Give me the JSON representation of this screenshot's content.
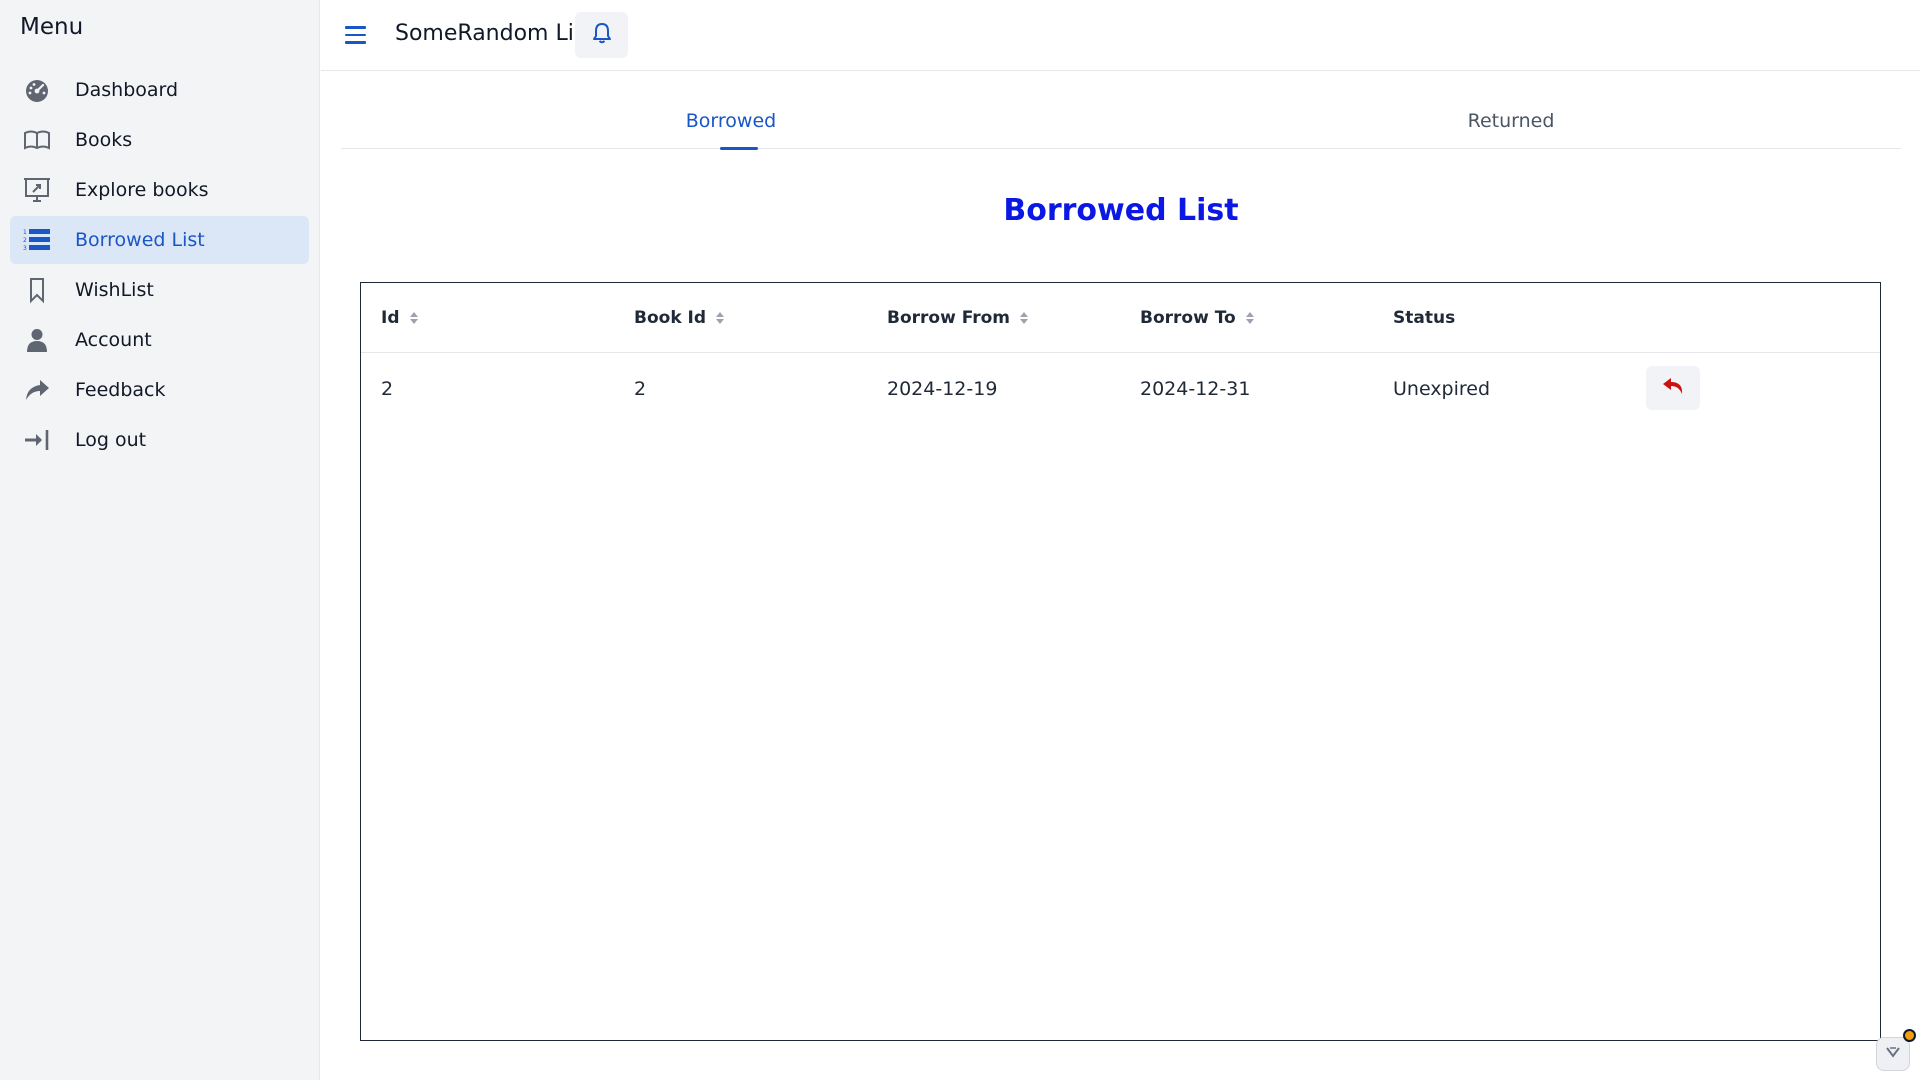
{
  "sidebar": {
    "title": "Menu",
    "items": [
      {
        "label": "Dashboard",
        "icon": "dashboard-gauge-icon",
        "active": false
      },
      {
        "label": "Books",
        "icon": "open-book-icon",
        "active": false
      },
      {
        "label": "Explore books",
        "icon": "explore-presentation-icon",
        "active": false
      },
      {
        "label": "Borrowed List",
        "icon": "ordered-list-icon",
        "active": true
      },
      {
        "label": "WishList",
        "icon": "bookmark-icon",
        "active": false
      },
      {
        "label": "Account",
        "icon": "user-icon",
        "active": false
      },
      {
        "label": "Feedback",
        "icon": "share-arrow-icon",
        "active": false
      },
      {
        "label": "Log out",
        "icon": "logout-icon",
        "active": false
      }
    ]
  },
  "header": {
    "title": "SomeRandom Lib",
    "menu_icon": "hamburger-icon",
    "bell_icon": "bell-icon"
  },
  "tabs": [
    {
      "label": "Borrowed",
      "active": true
    },
    {
      "label": "Returned",
      "active": false
    }
  ],
  "main": {
    "heading": "Borrowed List"
  },
  "table": {
    "columns": [
      {
        "label": "Id",
        "sortable": true
      },
      {
        "label": "Book Id",
        "sortable": true
      },
      {
        "label": "Borrow From",
        "sortable": true
      },
      {
        "label": "Borrow To",
        "sortable": true
      },
      {
        "label": "Status",
        "sortable": false
      }
    ],
    "rows": [
      {
        "id": "2",
        "book_id": "2",
        "borrow_from": "2024-12-19",
        "borrow_to": "2024-12-31",
        "status": "Unexpired",
        "action_icon": "return-arrow-icon"
      }
    ]
  },
  "colors": {
    "accent": "#1a56c4",
    "heading": "#0b18e3",
    "return_icon": "#cc1111",
    "sidebar_bg": "#f3f4f6",
    "active_bg": "#dbe6f6"
  }
}
